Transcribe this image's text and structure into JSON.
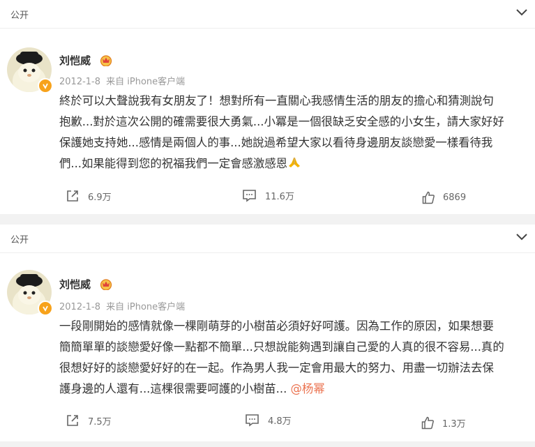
{
  "posts": [
    {
      "visibility": "公开",
      "author": "刘恺威",
      "date": "2012-1-8",
      "source": "来自 iPhone客户端",
      "lines": [
        "終於可以大聲說我有女朋友了！想對所有一直關心我感情生活的朋友的擔心和猜測說句",
        "抱歉...對於這次公開的確需要很大勇氣...小冪是一個很缺乏安全感的小女生，請大家好好",
        "保護她支持她...感情是兩個人的事...她說過希望大家以看待身邊朋友談戀愛一樣看待我",
        "們...如果能得到您的祝福我們一定會感激感恩"
      ],
      "emoji_icon": "pray-icon",
      "reposts": "6.9万",
      "comments": "11.6万",
      "likes": "6869"
    },
    {
      "visibility": "公开",
      "author": "刘恺威",
      "date": "2012-1-8",
      "source": "来自 iPhone客户端",
      "lines": [
        "一段剛開始的感情就像一棵剛萌芽的小樹苗必須好好呵護。因為工作的原因，如果想要",
        "簡簡單單的談戀愛好像一點都不簡單...只想說能夠遇到讓自己愛的人真的很不容易...真的",
        "很想好好的談戀愛好好的在一起。作為男人我一定會用最大的努力、用盡一切辦法去保",
        "護身邊的人還有...這棵很需要呵護的小樹苗... "
      ],
      "mention": "@杨幂",
      "reposts": "7.5万",
      "comments": "4.8万",
      "likes": "1.3万"
    }
  ],
  "colors": {
    "background": "#f2f2f2",
    "card": "#ffffff",
    "text": "#333333",
    "meta": "#999999",
    "mention": "#eb7350",
    "vip": "#f7a21b"
  }
}
